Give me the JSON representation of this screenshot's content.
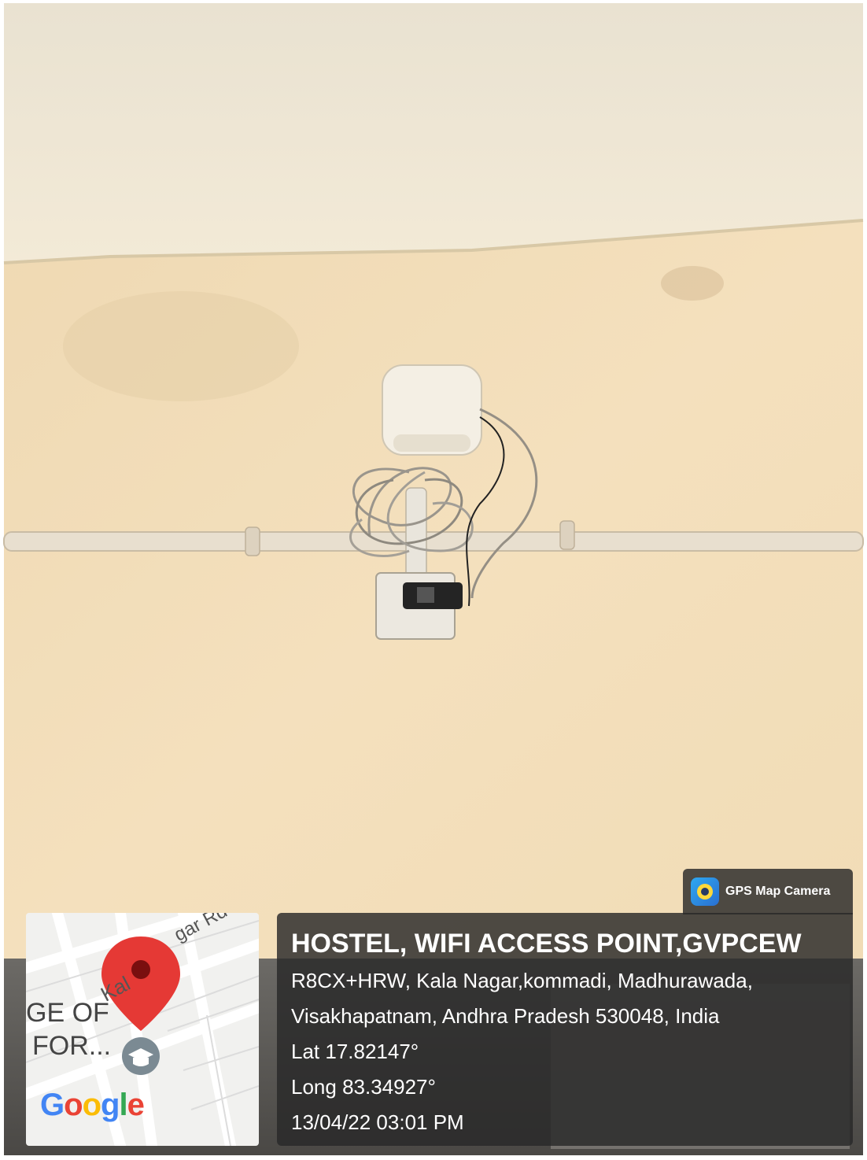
{
  "app_badge": {
    "icon": "gps-map-camera-app-icon",
    "label": "GPS Map Camera"
  },
  "location": {
    "title": "HOSTEL, WIFI ACCESS POINT,GVPCEW",
    "address_line_1": "R8CX+HRW, Kala Nagar,kommadi, Madhurawada,",
    "address_line_2": "Visakhapatnam, Andhra Pradesh 530048, India",
    "latitude": "Lat 17.82147°",
    "longitude": "Long 83.34927°",
    "timestamp": "13/04/22 03:01 PM"
  },
  "map_thumbnail": {
    "road_label": "Kal",
    "road_name": "gar Rd",
    "place_label_1": "GE OF",
    "place_label_2": "FOR...",
    "brand": [
      "G",
      "o",
      "o",
      "g",
      "l",
      "e"
    ],
    "pin_color": "#e53935",
    "place_icon": "graduation-cap-icon"
  },
  "colors": {
    "overlay": "#282828",
    "wall": "#f1ddb8",
    "ceiling": "#efe6d3"
  }
}
